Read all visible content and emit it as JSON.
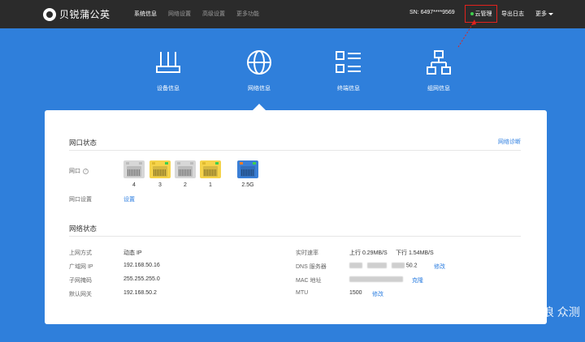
{
  "brand": {
    "name": "贝锐蒲公英"
  },
  "nav": [
    "系统信息",
    "网络设置",
    "高级设置",
    "更多功能"
  ],
  "header": {
    "sn": "SN: 6497****9569",
    "cloud": "云管理",
    "export": "导出日志",
    "more": "更多"
  },
  "tabs": [
    {
      "label": "设备信息",
      "icon": "router-icon"
    },
    {
      "label": "网络信息",
      "icon": "globe-icon"
    },
    {
      "label": "终端信息",
      "icon": "list-icon"
    },
    {
      "label": "组网信息",
      "icon": "network-tree-icon"
    }
  ],
  "port_status": {
    "title": "网口状态",
    "diagnose": "网络诊断",
    "port_label": "网口",
    "ports": [
      {
        "num": "4",
        "state": "idle",
        "color": "#d7d7d7"
      },
      {
        "num": "3",
        "state": "active",
        "color": "#f5d34a"
      },
      {
        "num": "2",
        "state": "idle",
        "color": "#d7d7d7"
      },
      {
        "num": "1",
        "state": "active",
        "color": "#f5d34a"
      },
      {
        "num": "2.5G",
        "state": "wan",
        "color": "#3a7fd6"
      }
    ],
    "setting_label": "网口设置",
    "setting_link": "设置"
  },
  "net_status": {
    "title": "网络状态",
    "left": [
      {
        "label": "上网方式",
        "value": "动态 IP"
      },
      {
        "label": "广域网 IP",
        "value": "192.168.50.16"
      },
      {
        "label": "子网掩码",
        "value": "255.255.255.0"
      },
      {
        "label": "默认网关",
        "value": "192.168.50.2"
      }
    ],
    "rate_label": "实时速率",
    "rate_up": "上行 0.29MB/S",
    "rate_down": "下行 1.54MB/S",
    "dns_label": "DNS 服务器",
    "dns_tail": "50.2",
    "dns_edit": "修改",
    "mac_label": "MAC 地址",
    "mac_action": "克隆",
    "mtu_label": "MTU",
    "mtu_value": "1500",
    "mtu_edit": "修改"
  },
  "watermark": "新 浪 众测"
}
